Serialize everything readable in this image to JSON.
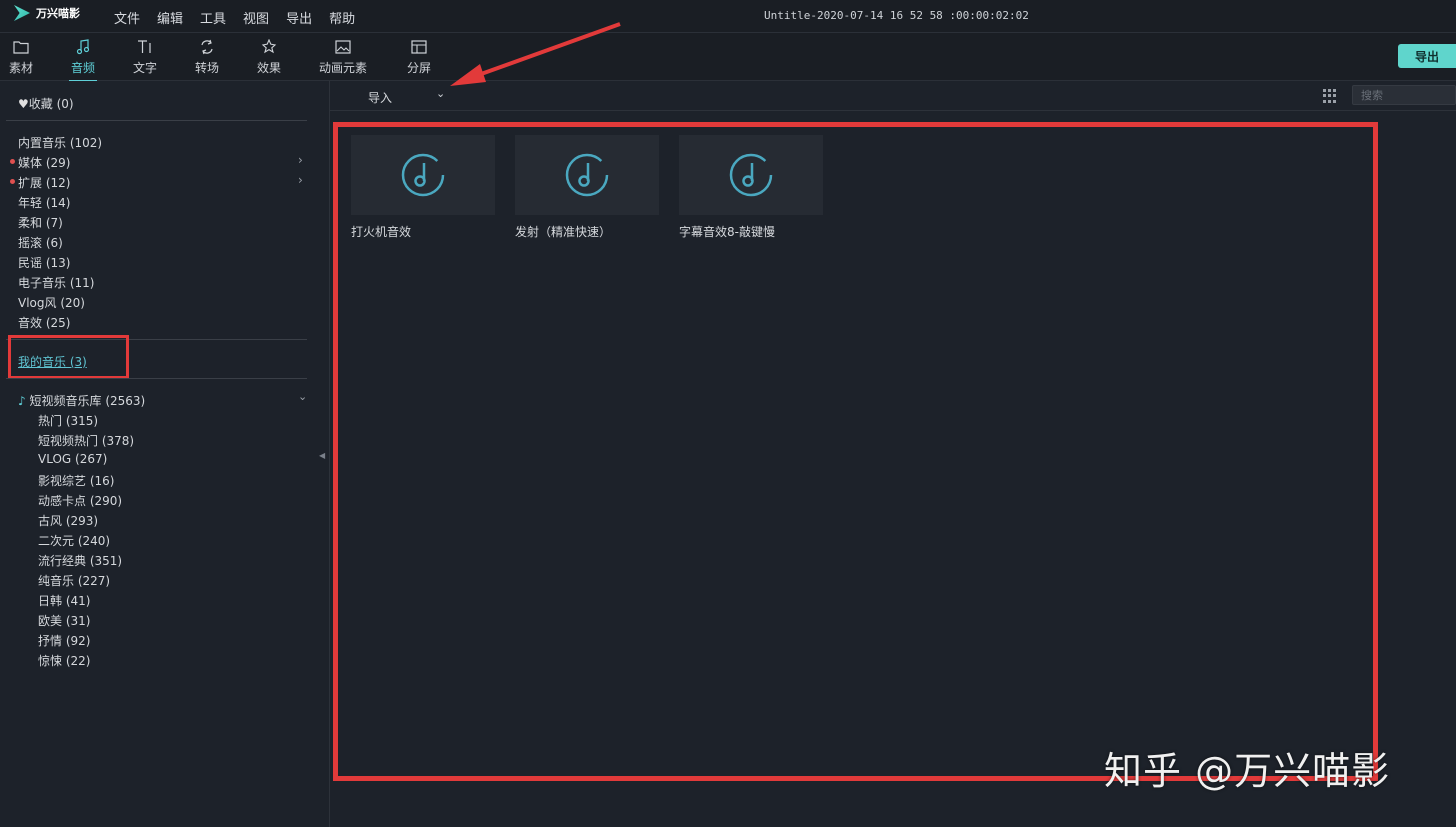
{
  "app": {
    "name": "万兴喵影",
    "window_title": "Untitle-2020-07-14 16 52 58 :00:00:02:02"
  },
  "menu": [
    "文件",
    "编辑",
    "工具",
    "视图",
    "导出",
    "帮助"
  ],
  "tabs": [
    {
      "label": "素材",
      "icon": "folder-icon"
    },
    {
      "label": "音频",
      "icon": "music-note-icon",
      "active": true
    },
    {
      "label": "文字",
      "icon": "text-icon"
    },
    {
      "label": "转场",
      "icon": "transition-icon"
    },
    {
      "label": "效果",
      "icon": "effects-icon"
    },
    {
      "label": "动画元素",
      "icon": "image-icon"
    },
    {
      "label": "分屏",
      "icon": "split-screen-icon"
    }
  ],
  "export_label": "导出",
  "sidebar": {
    "favorites": "收藏 (0)",
    "builtin": [
      {
        "label": "内置音乐 (102)"
      },
      {
        "label": "媒体 (29)",
        "dot": true,
        "chevron": true
      },
      {
        "label": "扩展 (12)",
        "dot": true,
        "chevron": true
      },
      {
        "label": "年轻 (14)"
      },
      {
        "label": "柔和 (7)"
      },
      {
        "label": "摇滚 (6)"
      },
      {
        "label": "民谣 (13)"
      },
      {
        "label": "电子音乐 (11)"
      },
      {
        "label": "Vlog风 (20)"
      },
      {
        "label": "音效 (25)"
      }
    ],
    "my_music": "我的音乐 (3)",
    "library_title": "短视频音乐库 (2563)",
    "library_items": [
      "热门 (315)",
      "短视频热门 (378)",
      "VLOG (267)",
      "影视综艺 (16)",
      "动感卡点 (290)",
      "古风 (293)",
      "二次元 (240)",
      "流行经典 (351)",
      "纯音乐 (227)",
      "日韩 (41)",
      "欧美 (31)",
      "抒情 (92)",
      "惊悚 (22)"
    ]
  },
  "content": {
    "import_label": "导入",
    "search_placeholder": "搜索",
    "items": [
      {
        "label": "打火机音效"
      },
      {
        "label": "发射（精准快速）"
      },
      {
        "label": "字幕音效8-敲键慢"
      }
    ]
  },
  "watermark": "知乎 @万兴喵影",
  "colors": {
    "accent": "#5fd0d8",
    "annotation": "#e23a3a",
    "background": "#1d222a"
  }
}
